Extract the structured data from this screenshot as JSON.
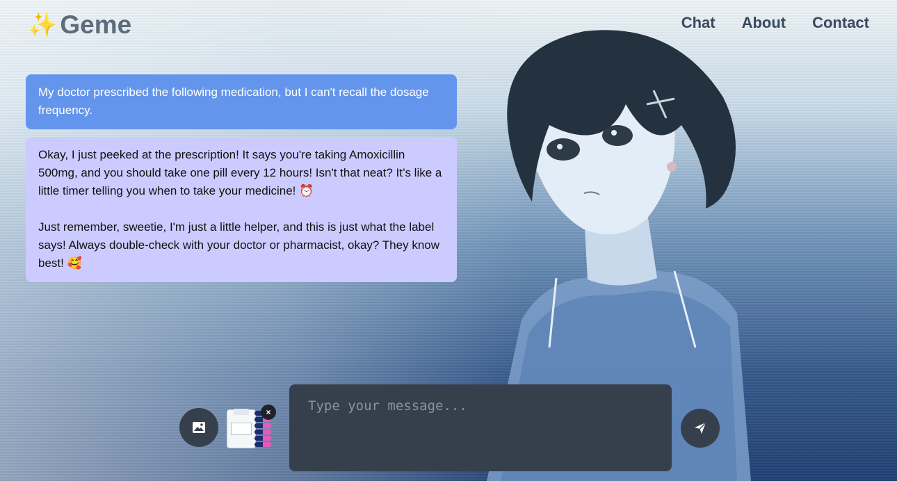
{
  "header": {
    "logo_icon": "sparkles-emoji",
    "logo_glyph": "✨",
    "app_name": "Geme",
    "nav": [
      {
        "label": "Chat"
      },
      {
        "label": "About"
      },
      {
        "label": "Contact"
      }
    ]
  },
  "chat": {
    "messages": [
      {
        "role": "user",
        "text": "My doctor prescribed the following medication, but I can't recall the dosage frequency."
      },
      {
        "role": "assistant",
        "text": "Okay, I just peeked at the prescription! It says you're taking Amoxicillin 500mg, and you should take one pill every 12 hours! Isn't that neat? It’s like a little timer telling you when to take your medicine! ⏰\n\nJust remember, sweetie, I'm just a little helper, and this is just what the label says! Always double-check with your doctor or pharmacist, okay? They know best! 🥰"
      }
    ]
  },
  "composer": {
    "image_button_icon": "image-icon",
    "attachment_icon": "medication-photo-thumbnail",
    "remove_attachment_glyph": "×",
    "input_placeholder": "Type your message...",
    "input_value": "",
    "send_button_icon": "paper-plane-icon"
  },
  "colors": {
    "user_bubble": "#6495ed",
    "assistant_bubble": "#cccbff",
    "composer_bg": "#36404c"
  }
}
